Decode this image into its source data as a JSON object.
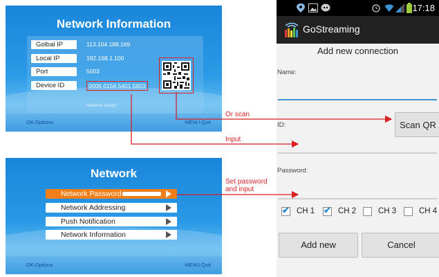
{
  "network_info_screen": {
    "title": "Network Information",
    "rows": [
      {
        "label": "Golbal IP",
        "value": "113.104.188.169"
      },
      {
        "label": "Local IP",
        "value": "192.168.1.100"
      },
      {
        "label": "Port",
        "value": "5003"
      },
      {
        "label": "Device ID",
        "value": "0006 0156 5401 5603"
      }
    ],
    "status": "Network ready!",
    "footer_left": "OK:Options",
    "footer_right": "MENU:Quit"
  },
  "network_menu_screen": {
    "title": "Network",
    "items": [
      {
        "label": "Network Password",
        "selected": true
      },
      {
        "label": "Network Addressing",
        "selected": false
      },
      {
        "label": "Push Notification",
        "selected": false
      },
      {
        "label": "Network Information",
        "selected": false
      }
    ],
    "footer_left": "OK:Options",
    "footer_right": "MENU:Quit"
  },
  "annotations": {
    "or_scan": "Or scan",
    "input": "Input",
    "set_password_line1": "Set password",
    "set_password_line2": "and input",
    "color": "#d81f26"
  },
  "phone": {
    "status_time": "17:18",
    "app_title": "GoStreaming",
    "screen_title": "Add new connection",
    "name_label": "Name:",
    "id_label": "ID:",
    "password_label": "Password:",
    "scan_button": "Scan QR",
    "channels": [
      {
        "label": "CH 1",
        "checked": true
      },
      {
        "label": "CH 2",
        "checked": true
      },
      {
        "label": "CH 3",
        "checked": false
      },
      {
        "label": "CH 4",
        "checked": false
      }
    ],
    "add_button": "Add new",
    "cancel_button": "Cancel",
    "accent_color": "#3b93d4"
  }
}
